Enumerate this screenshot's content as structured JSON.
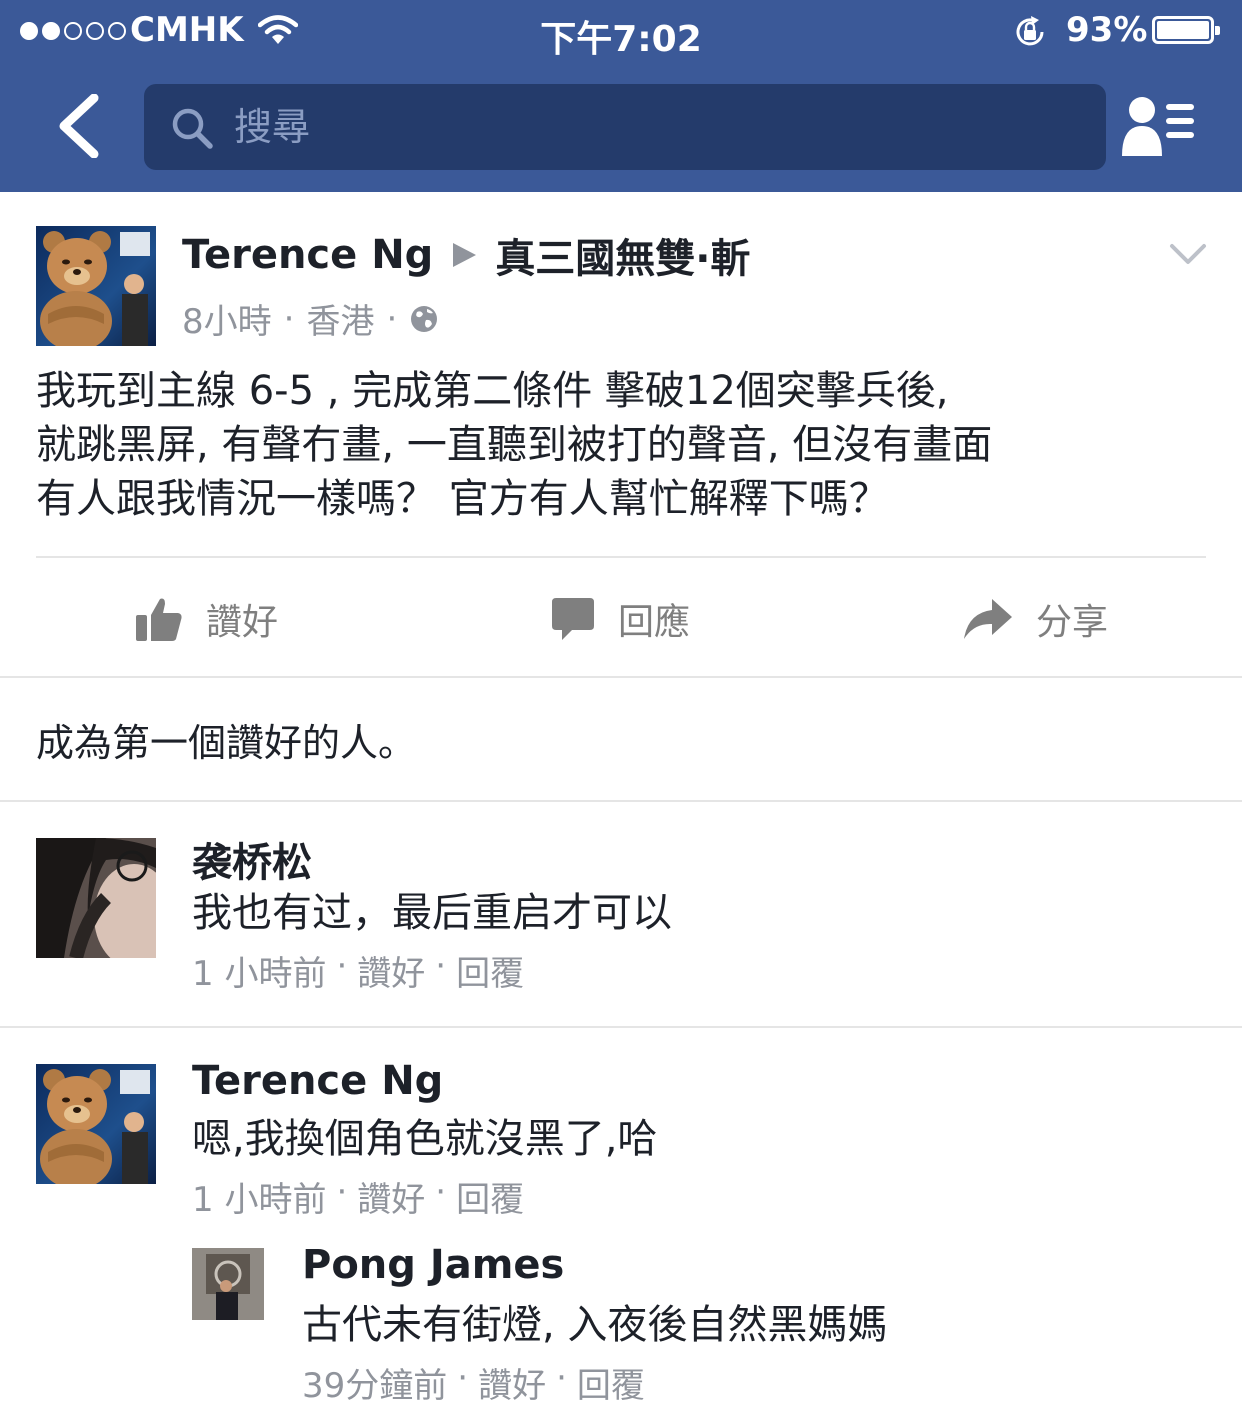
{
  "status_bar": {
    "carrier": "CMHK",
    "signal_strength": 2,
    "signal_max": 5,
    "time": "下午7:02",
    "battery_percent": "93%",
    "battery_level": 0.93
  },
  "nav": {
    "back_icon": "chevron-left-icon",
    "search_placeholder": "搜尋",
    "friend_requests_icon": "friend-list-icon"
  },
  "post": {
    "author": "Terence Ng",
    "target_group": "真三國無雙·斬",
    "time": "8小時",
    "location": "香港",
    "separator": "·",
    "privacy_icon": "globe-icon",
    "text_lines": [
      "我玩到主線 6-5 , 完成第二條件 擊破12個突擊兵後,",
      "就跳黑屏, 有聲冇畫, 一直聽到被打的聲音, 但沒有畫面",
      "有人跟我情況一樣嗎？ 官方有人幫忙解釋下嗎？"
    ],
    "actions": {
      "like": "讚好",
      "comment": "回應",
      "share": "分享"
    },
    "likes_summary": "成為第一個讚好的人。"
  },
  "comments": [
    {
      "name": "袭桥松",
      "text": "我也有过，最后重启才可以",
      "time": "1 小時前",
      "like": "讚好",
      "reply": "回覆",
      "sep": "·"
    },
    {
      "name": "Terence Ng",
      "text": "嗯,我換個角色就沒黑了,哈",
      "time": "1 小時前",
      "like": "讚好",
      "reply": "回覆",
      "sep": "·"
    }
  ],
  "reply": {
    "name": "Pong James",
    "text": "古代未有街燈, 入夜後自然黑媽媽",
    "time": "39分鐘前",
    "like": "讚好",
    "reply": "回覆",
    "sep": "·"
  },
  "colors": {
    "brand": "#3b5998",
    "search_bg": "#243b6b",
    "muted_text": "#90949c",
    "action_gray": "#7f7f7f",
    "divider": "#e5e5e5"
  }
}
